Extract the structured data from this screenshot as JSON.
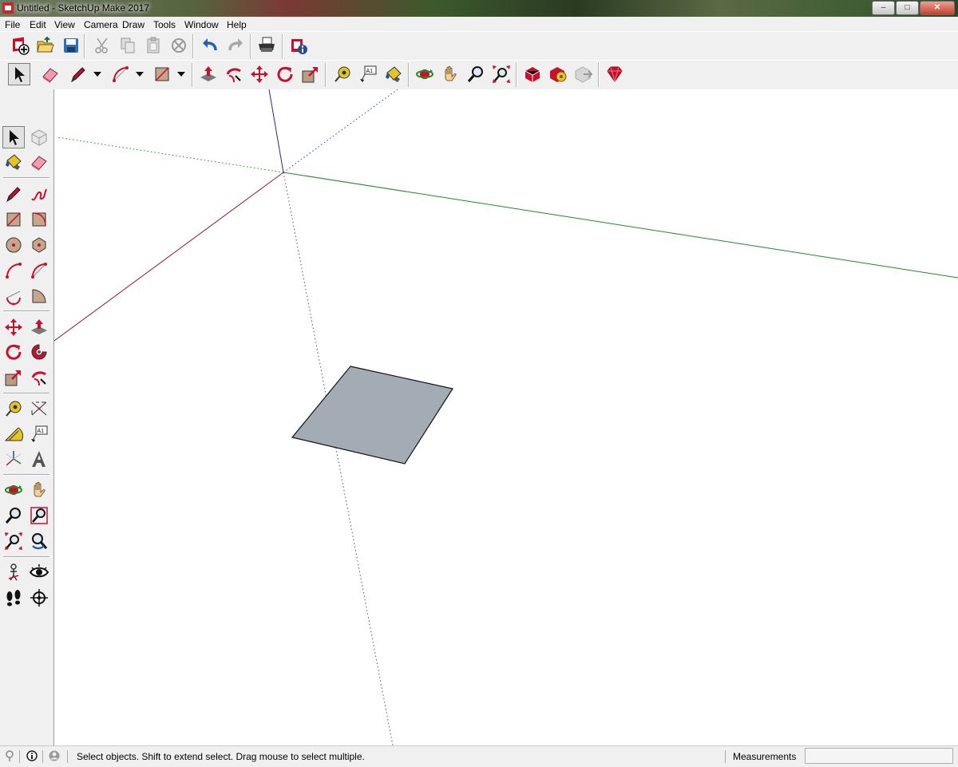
{
  "window": {
    "title": "Untitled - SketchUp Make 2017",
    "controls": {
      "minimize": "–",
      "maximize": "□",
      "close": "✕"
    }
  },
  "menu": [
    "File",
    "Edit",
    "View",
    "Camera",
    "Draw",
    "Tools",
    "Window",
    "Help"
  ],
  "status": {
    "message": "Select objects. Shift to extend select. Drag mouse to select multiple.",
    "measurements_label": "Measurements",
    "measurements_value": ""
  },
  "icons": {
    "standard_toolbar": [
      "new-icon",
      "open-icon",
      "save-icon",
      "cut-icon",
      "copy-icon",
      "paste-icon",
      "erase-icon",
      "undo-icon",
      "redo-icon",
      "print-icon",
      "model-info-icon"
    ],
    "main_toolbar": [
      "select-icon",
      "eraser-icon",
      "pencil-icon",
      "arc-icon",
      "rectangle-icon",
      "push-pull-icon",
      "follow-me-icon",
      "move-icon",
      "rotate-icon",
      "scale-icon",
      "tape-measure-icon",
      "text-icon",
      "paint-bucket-icon",
      "orbit-icon",
      "pan-icon",
      "zoom-icon",
      "zoom-extents-icon",
      "3d-warehouse-icon",
      "extension-warehouse-icon",
      "share-model-icon",
      "ruby-console-icon"
    ]
  },
  "colors": {
    "red_axis": "#8b1a2b",
    "green_axis": "#1f8a1f",
    "blue_axis": "#2a2a8a",
    "face_fill": "#a3acb4",
    "accent_red": "#c8102e"
  }
}
